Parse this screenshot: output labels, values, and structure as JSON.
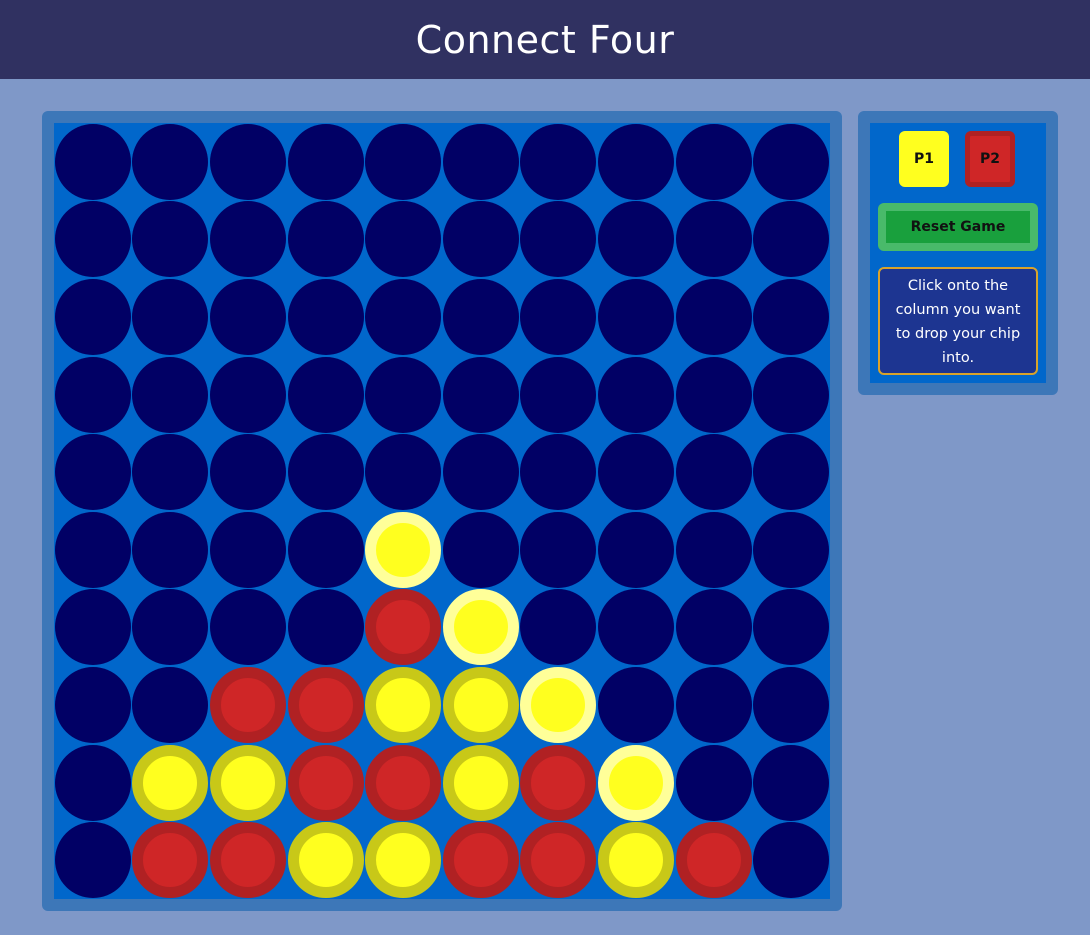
{
  "header": {
    "title": "Connect Four"
  },
  "players": {
    "p1_label": "P1",
    "p2_label": "P2"
  },
  "controls": {
    "reset_label": "Reset Game"
  },
  "instructions": "Click onto the column you want to drop your chip into.",
  "colors": {
    "header_bg": "#303161",
    "page_bg": "#7f98c8",
    "board_bg": "#0167cb",
    "empty_slot": "#010065",
    "p1_chip": "#ffff1f",
    "p2_chip": "#cf2627",
    "winning_ring": "#ffff99",
    "reset_button": "#19a03d"
  },
  "board": {
    "columns": 10,
    "rows": 10,
    "grid": [
      [
        0,
        0,
        0,
        0,
        0,
        0,
        0,
        0,
        0,
        0
      ],
      [
        0,
        0,
        0,
        0,
        0,
        0,
        0,
        0,
        0,
        0
      ],
      [
        0,
        0,
        0,
        0,
        0,
        0,
        0,
        0,
        0,
        0
      ],
      [
        0,
        0,
        0,
        0,
        0,
        0,
        0,
        0,
        0,
        0
      ],
      [
        0,
        0,
        0,
        0,
        0,
        0,
        0,
        0,
        0,
        0
      ],
      [
        0,
        0,
        0,
        0,
        1,
        0,
        0,
        0,
        0,
        0
      ],
      [
        0,
        0,
        0,
        0,
        2,
        1,
        0,
        0,
        0,
        0
      ],
      [
        0,
        0,
        2,
        2,
        1,
        1,
        1,
        0,
        0,
        0
      ],
      [
        0,
        1,
        1,
        2,
        2,
        1,
        2,
        1,
        0,
        0
      ],
      [
        0,
        2,
        2,
        1,
        1,
        2,
        2,
        1,
        2,
        0
      ]
    ],
    "winning_cells": [
      [
        5,
        4
      ],
      [
        6,
        5
      ],
      [
        7,
        6
      ],
      [
        8,
        7
      ]
    ]
  }
}
